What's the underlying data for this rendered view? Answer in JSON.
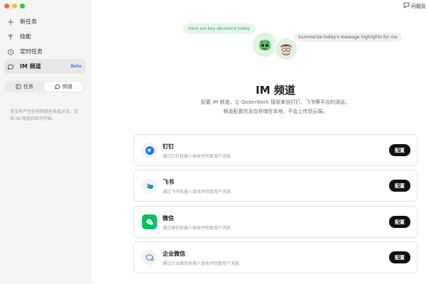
{
  "sidebar": {
    "items": [
      {
        "label": "新任务",
        "icon": "plus-icon"
      },
      {
        "label": "技能",
        "icon": "skill-icon"
      },
      {
        "label": "定时任务",
        "icon": "clock-icon"
      },
      {
        "label": "IM 频道",
        "icon": "chat-icon",
        "badge": "Beta",
        "active": true
      }
    ],
    "segment": [
      {
        "label": "任务",
        "icon": "task-icon"
      },
      {
        "label": "频道",
        "icon": "chat-icon",
        "active": true
      }
    ],
    "empty_text": "还没有产生任何频道任务或对话，连接 IM 频道后即可开始。"
  },
  "topbar": {
    "feedback_label": "问题反",
    "feedback_icon": "feedback-icon"
  },
  "hero": {
    "bubble_left": "Here are key decisions today.",
    "bubble_right": "Summarize today's message highlights for me",
    "title": "IM 频道",
    "desc_line1": "配置 IM 频道，让 QoderWork 接收来自钉钉、飞书等平台的消息。",
    "desc_line2": "频道配置信息仅存储在本地，不会上传到云端。"
  },
  "channels": [
    {
      "name": "钉钉",
      "desc": "通过钉钉机器人接收并回复用户消息",
      "button": "配置",
      "icon": "dingtalk-icon",
      "color": "#1677ff"
    },
    {
      "name": "飞书",
      "desc": "通过飞书机器人接收并回复用户消息",
      "button": "配置",
      "icon": "feishu-icon",
      "color": "#00b96b"
    },
    {
      "name": "微信",
      "desc": "通过微信机器人接收并回复用户消息",
      "button": "配置",
      "icon": "wechat-icon",
      "color": "#07c160"
    },
    {
      "name": "企业微信",
      "desc": "通过企业微信机器人接收并回复用户消息",
      "button": "配置",
      "icon": "wecom-icon",
      "color": "#2f7de1"
    }
  ],
  "colors": {
    "accent_beta": "#3b82f6",
    "button_bg": "#111111",
    "bubble_green": "#3aa55b"
  }
}
